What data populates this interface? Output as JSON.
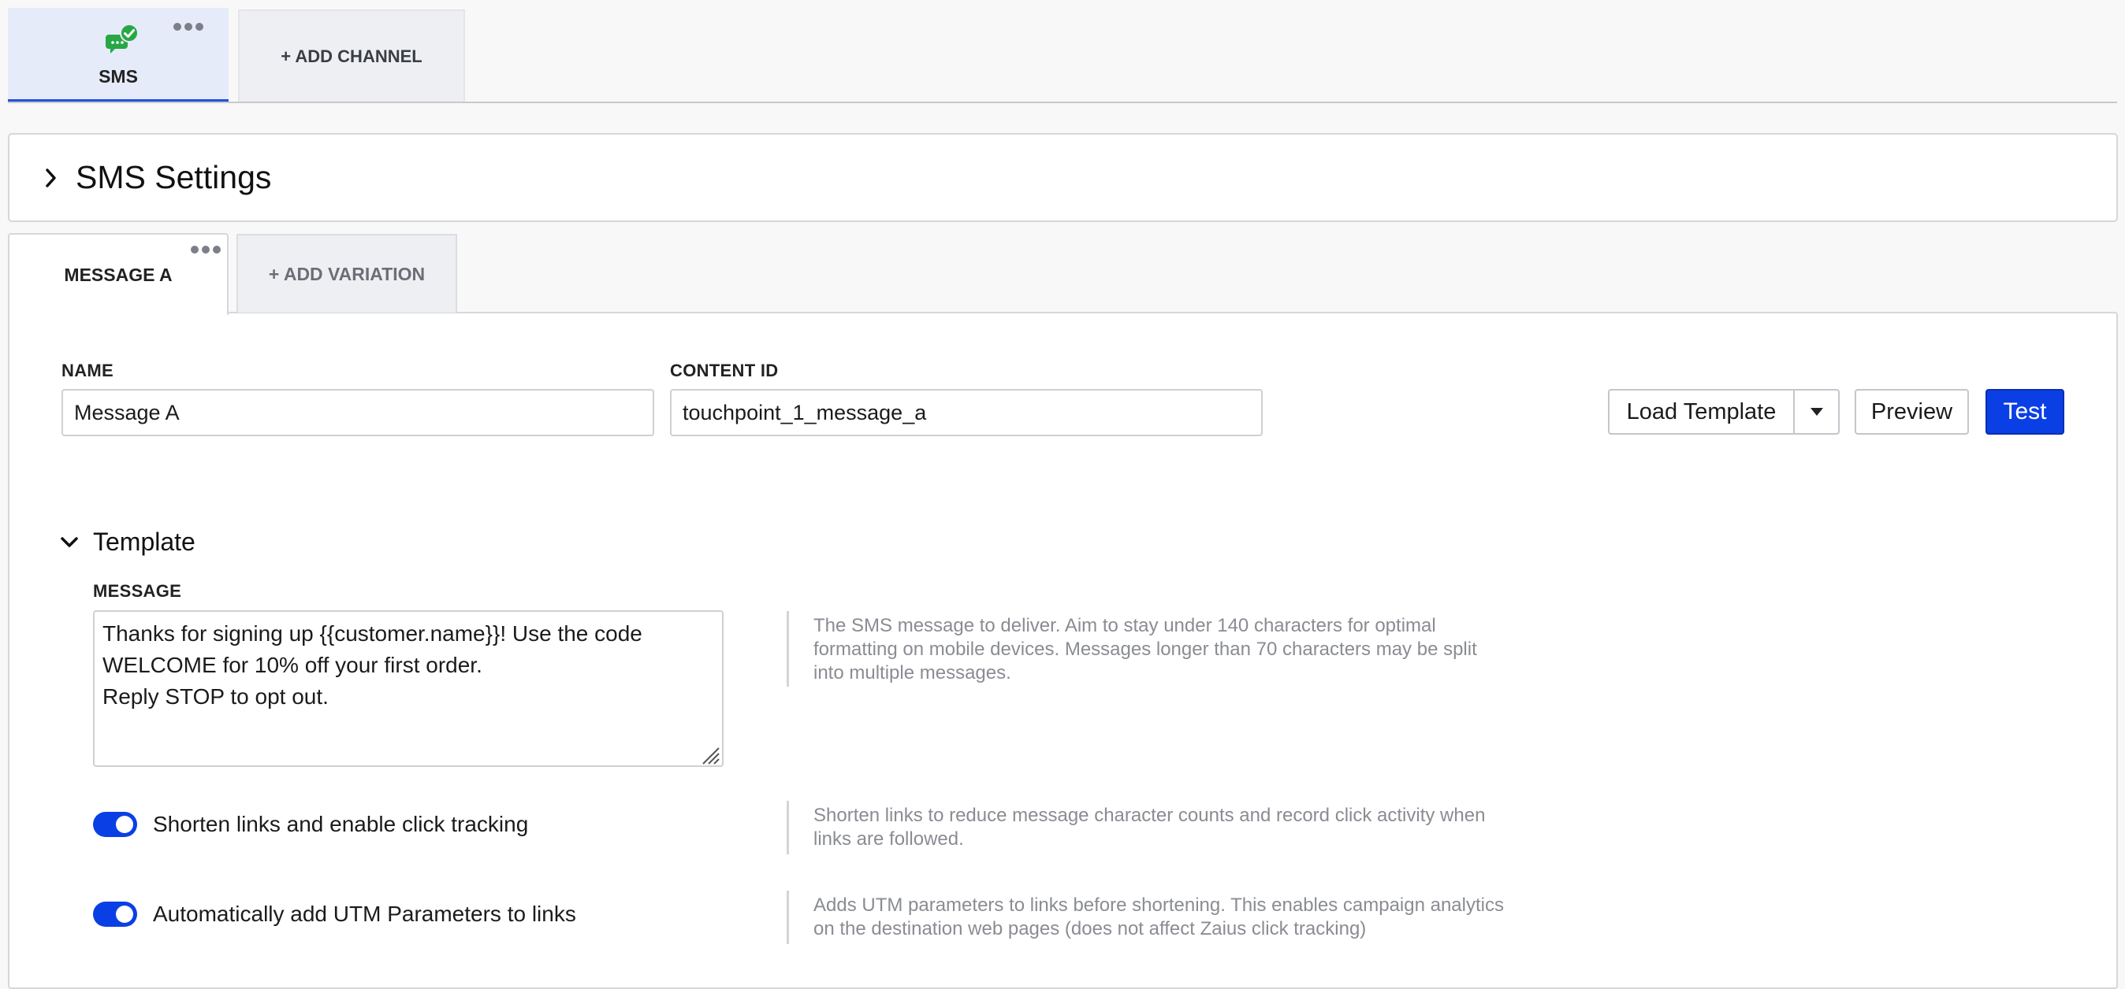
{
  "channels": {
    "tabs": [
      {
        "label": "SMS",
        "icon": "sms-check-icon",
        "active": true
      }
    ],
    "add_label": "+ ADD CHANNEL"
  },
  "settings": {
    "title": "SMS Settings"
  },
  "messages": {
    "tabs": [
      {
        "label": "MESSAGE A",
        "active": true
      }
    ],
    "add_label": "+ ADD VARIATION"
  },
  "form": {
    "name": {
      "label": "NAME",
      "value": "Message A"
    },
    "content_id": {
      "label": "CONTENT ID",
      "value": "touchpoint_1_message_a"
    }
  },
  "toolbar": {
    "load_template": "Load Template",
    "preview": "Preview",
    "test": "Test"
  },
  "template": {
    "title": "Template",
    "message_label": "MESSAGE",
    "message_value": "Thanks for signing up {{customer.name}}! Use the code\nWELCOME for 10% off your first order.\nReply STOP to opt out.",
    "message_help": "The SMS message to deliver. Aim to stay under 140 characters for optimal formatting on mobile devices. Messages longer than 70 characters may be split into multiple messages."
  },
  "options": [
    {
      "label": "Shorten links and enable click tracking",
      "enabled": true,
      "help": "Shorten links to reduce message character counts and record click activity when links are followed."
    },
    {
      "label": "Automatically add UTM Parameters to links",
      "enabled": true,
      "help": "Adds UTM parameters to links before shortening. This enables campaign analytics on the destination web pages (does not affect Zaius click tracking)"
    }
  ],
  "colors": {
    "accent": "#0b3fe6",
    "active_tab_bg": "#e6ebfa",
    "sms_icon": "#28a745",
    "help_text": "#8a8c93"
  }
}
